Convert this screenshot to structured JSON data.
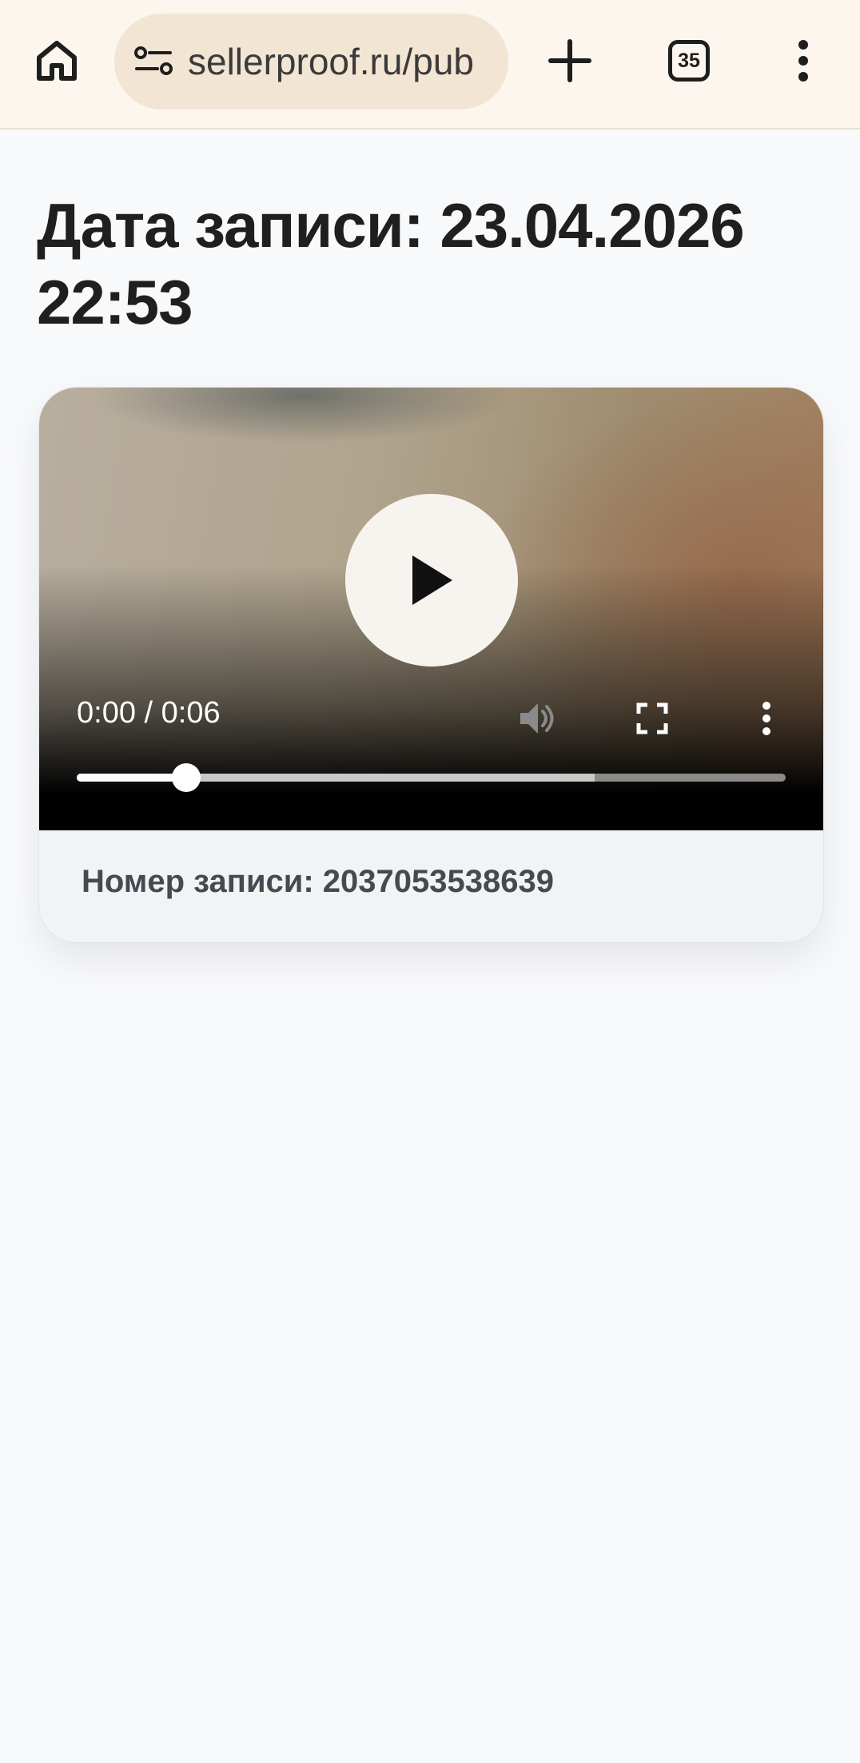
{
  "browser": {
    "url": "sellerproof.ru/pub",
    "tab_count": "35",
    "icons": [
      "home-icon",
      "site-settings-icon",
      "new-tab-icon",
      "tab-switcher-icon",
      "more-menu-icon"
    ]
  },
  "page": {
    "title": "Дата записи: 23.04.2026 22:53"
  },
  "video": {
    "time_display": "0:00 / 0:06",
    "progress_played_fraction": 0.155,
    "progress_buffered_fraction": 0.73,
    "icons": [
      "play-icon",
      "mute-icon",
      "fullscreen-icon",
      "more-options-icon"
    ]
  },
  "record": {
    "label": "Номер записи: 2037053538639"
  }
}
